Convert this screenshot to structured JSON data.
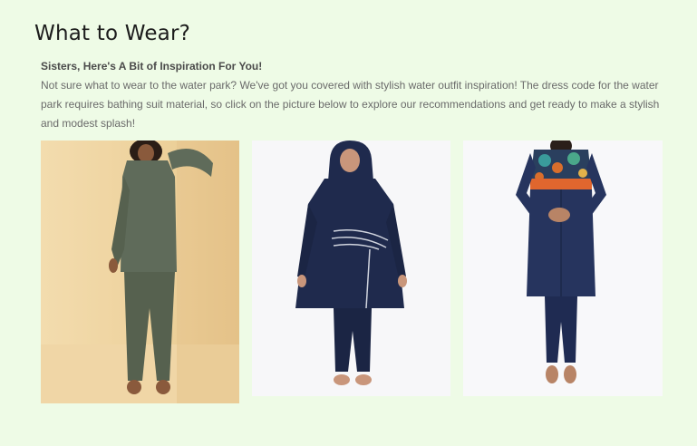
{
  "section": {
    "title": "What to Wear?",
    "subheading": "Sisters, Here's A Bit of Inspiration For You!",
    "description": "Not sure what to wear to the water park? We've got you covered with stylish water outfit inspiration! The dress code for the water park requires bathing suit material, so click on the picture below to explore our recommendations and get ready to make a stylish and modest splash!"
  },
  "gallery": [
    {
      "name": "olive-green-modest-swimwear-photo",
      "outfit_color": "#5f6b5a",
      "background_color": "#f1d7a7"
    },
    {
      "name": "navy-burkini-with-hijab-photo",
      "outfit_color": "#1f2a4d",
      "background_color": "#f7f7f9"
    },
    {
      "name": "navy-floral-modest-swimsuit-photo",
      "outfit_color": "#26345e",
      "accent_color": "#e0662e",
      "background_color": "#f8f8fa"
    }
  ]
}
